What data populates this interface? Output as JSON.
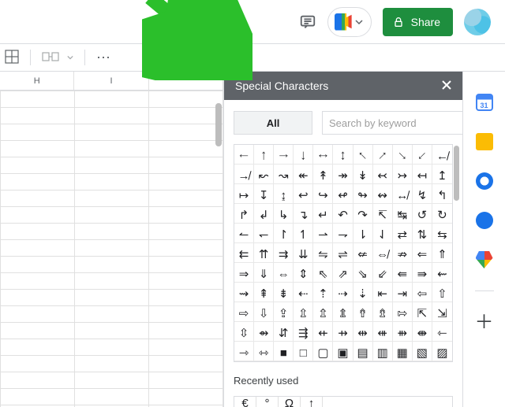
{
  "header": {
    "share_label": "Share"
  },
  "sheet": {
    "columns": [
      "H",
      "I"
    ]
  },
  "panel": {
    "title": "Special Characters",
    "tab_all": "All",
    "search_placeholder": "Search by keyword",
    "recent_label": "Recently used"
  },
  "chars": [
    "←",
    "↑",
    "→",
    "↓",
    "↔",
    "↕",
    "↖",
    "↗",
    "↘",
    "↙",
    "↚",
    "↛",
    "↜",
    "↝",
    "↞",
    "↟",
    "↠",
    "↡",
    "↢",
    "↣",
    "↤",
    "↥",
    "↦",
    "↧",
    "↨",
    "↩",
    "↪",
    "↫",
    "↬",
    "↭",
    "↮",
    "↯",
    "↰",
    "↱",
    "↲",
    "↳",
    "↴",
    "↵",
    "↶",
    "↷",
    "↸",
    "↹",
    "↺",
    "↻",
    "↼",
    "↽",
    "↾",
    "↿",
    "⇀",
    "⇁",
    "⇂",
    "⇃",
    "⇄",
    "⇅",
    "⇆",
    "⇇",
    "⇈",
    "⇉",
    "⇊",
    "⇋",
    "⇌",
    "⇍",
    "⇎",
    "⇏",
    "⇐",
    "⇑",
    "⇒",
    "⇓",
    "⇔",
    "⇕",
    "⇖",
    "⇗",
    "⇘",
    "⇙",
    "⇚",
    "⇛",
    "⇜",
    "⇝",
    "⇞",
    "⇟",
    "⇠",
    "⇡",
    "⇢",
    "⇣",
    "⇤",
    "⇥",
    "⇦",
    "⇧",
    "⇨",
    "⇩",
    "⇪",
    "⇫",
    "⇬",
    "⇭",
    "⇮",
    "⇯",
    "⇰",
    "⇱",
    "⇲",
    "⇳",
    "⇴",
    "⇵",
    "⇶",
    "⇷",
    "⇸",
    "⇹",
    "⇺",
    "⇻",
    "⇼",
    "⇽",
    "⇾",
    "⇿",
    "■",
    "□",
    "▢",
    "▣",
    "▤",
    "▥",
    "▦",
    "▧",
    "▨"
  ],
  "recent": [
    "€",
    "°",
    "Ω",
    "↑"
  ]
}
